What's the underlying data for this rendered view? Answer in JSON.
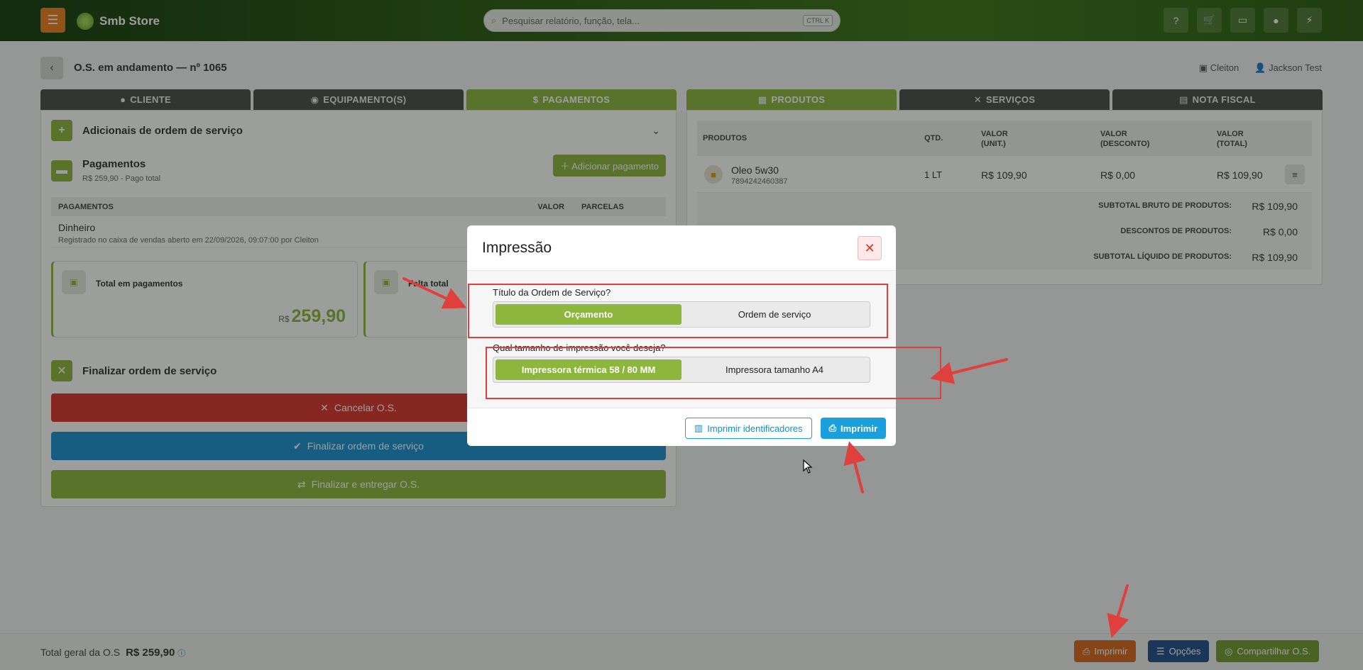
{
  "topbar": {
    "brand": "Smb Store",
    "search_placeholder": "Pesquisar relatório, função, tela...",
    "search_kbd": "CTRL K",
    "icons": [
      "help-icon",
      "cart-icon",
      "monitor-icon",
      "chat-icon",
      "bolt-icon"
    ]
  },
  "header": {
    "title": "O.S. em andamento — nº 1065",
    "store": "Cleiton",
    "user": "Jackson Test"
  },
  "left_tabs": [
    "CLIENTE",
    "EQUIPAMENTO(S)",
    "PAGAMENTOS"
  ],
  "right_tabs": [
    "PRODUTOS",
    "SERVIÇOS",
    "NOTA FISCAL"
  ],
  "left": {
    "adicionais_title": "Adicionais de ordem de serviço",
    "pagamentos_title": "Pagamentos",
    "pagamentos_sub": "R$ 259,90 - Pago total",
    "add_payment": "Adicionar pagamento",
    "table_headers": [
      "PAGAMENTOS",
      "VALOR",
      "PARCELAS"
    ],
    "payment_method": "Dinheiro",
    "payment_note": "Registrado no caixa de vendas aberto em 22/09/2026, 09:07:00 por Cleiton",
    "card_total_label": "Total em pagamentos",
    "card_total_currency": "R$",
    "card_total_value": "259,90",
    "card_falta_label": "Falta total",
    "finalizar_title": "Finalizar ordem de serviço",
    "btn_cancelar": "Cancelar O.S.",
    "btn_finalizar": "Finalizar ordem de serviço",
    "btn_entregar": "Finalizar e entregar O.S."
  },
  "right": {
    "headers": [
      "PRODUTOS",
      "QTD.",
      "VALOR (UNIT.)",
      "VALOR (DESCONTO)",
      "VALOR (TOTAL)"
    ],
    "product_name": "Oleo 5w30",
    "product_code": "7894242460387",
    "qty": "1 LT",
    "unit": "R$ 109,90",
    "discount": "R$ 0,00",
    "total": "R$ 109,90",
    "subtotal_bruto_label": "SUBTOTAL BRUTO DE PRODUTOS:",
    "subtotal_bruto": "R$ 109,90",
    "descontos_label": "DESCONTOS DE PRODUTOS:",
    "descontos": "R$ 0,00",
    "subtotal_liquido_label": "SUBTOTAL LÍQUIDO DE PRODUTOS:",
    "subtotal_liquido": "R$ 109,90"
  },
  "modal": {
    "title": "Impressão",
    "q1": "Título da Ordem de Serviço?",
    "q1_opt1": "Orçamento",
    "q1_opt2": "Ordem de serviço",
    "q2": "Qual tamanho de impressão você deseja?",
    "q2_opt1": "Impressora térmica 58 / 80 MM",
    "q2_opt2": "Impressora tamanho A4",
    "btn_identificadores": "Imprimir identificadores",
    "btn_imprimir": "Imprimir"
  },
  "bottom": {
    "total_label": "Total geral da O.S",
    "total_value": "R$ 259,90",
    "btn_imprimir": "Imprimir",
    "btn_opcoes": "Opções",
    "btn_compartilhar": "Compartilhar O.S."
  },
  "colors": {
    "accent_green": "#8cb63c",
    "orange": "#f07d1d",
    "red": "#d9342b",
    "blue": "#1aa0dc",
    "annotation_red": "#e0403c"
  }
}
